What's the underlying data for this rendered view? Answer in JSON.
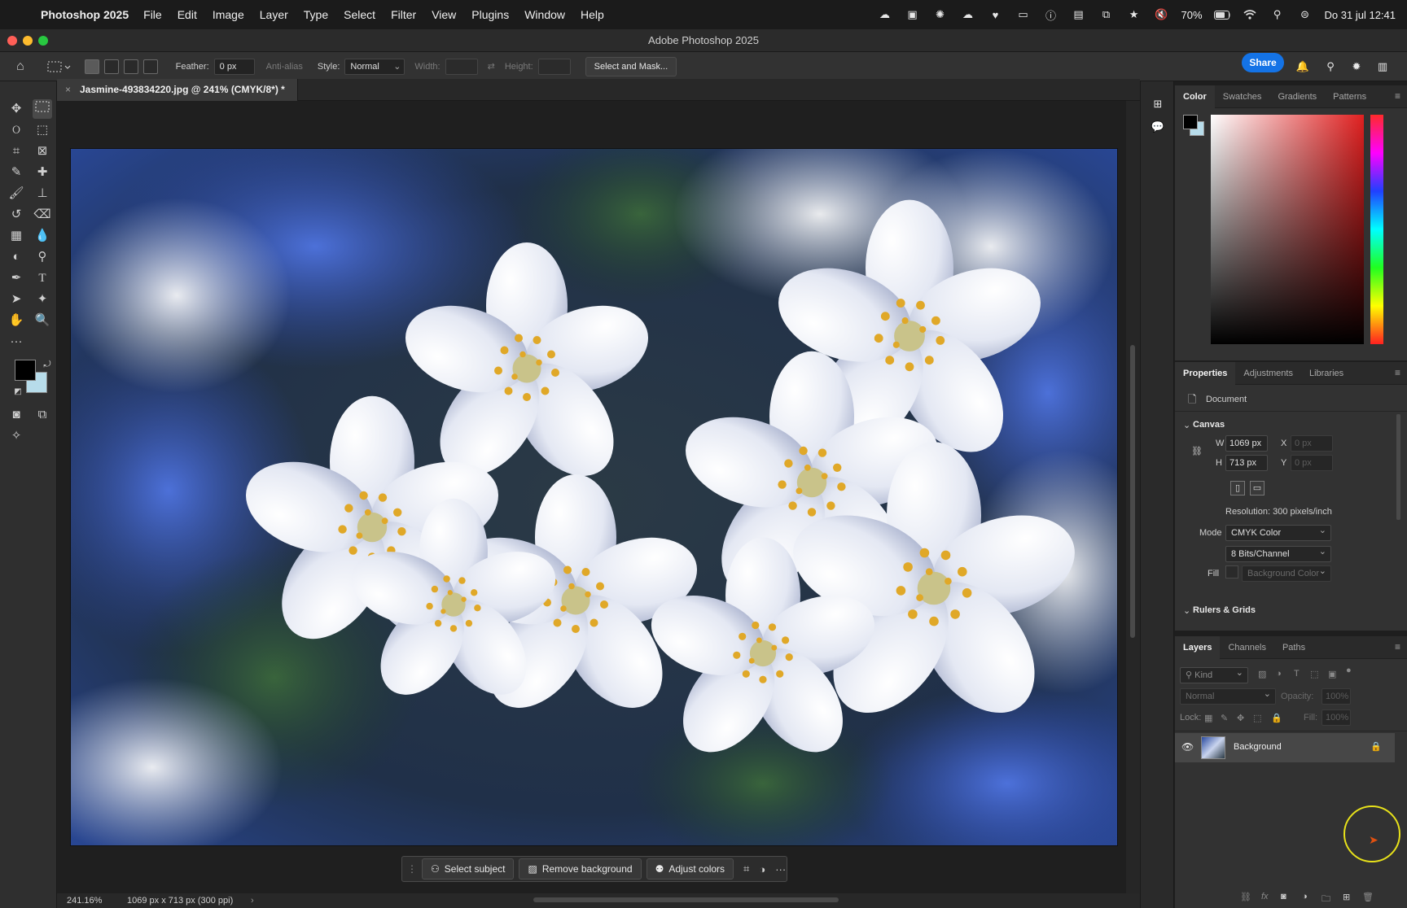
{
  "menubar": {
    "app_name": "Photoshop 2025",
    "menus": [
      "File",
      "Edit",
      "Image",
      "Layer",
      "Type",
      "Select",
      "Filter",
      "View",
      "Plugins",
      "Window",
      "Help"
    ],
    "battery": "70%",
    "datetime": "Do 31 jul  12:41"
  },
  "window": {
    "title": "Adobe Photoshop 2025"
  },
  "options_bar": {
    "feather_label": "Feather:",
    "feather_value": "0 px",
    "anti_alias": "Anti-alias",
    "style_label": "Style:",
    "style_value": "Normal",
    "width_label": "Width:",
    "height_label": "Height:",
    "select_mask": "Select and Mask...",
    "share": "Share"
  },
  "document": {
    "tab_title": "Jasmine-493834220.jpg @ 241% (CMYK/8*) *",
    "zoom": "241.16%",
    "info": "1069 px x 713 px (300 ppi)"
  },
  "context_bar": {
    "select_subject": "Select subject",
    "remove_background": "Remove background",
    "adjust_colors": "Adjust colors"
  },
  "color_panel": {
    "tabs": [
      "Color",
      "Swatches",
      "Gradients",
      "Patterns"
    ],
    "foreground": "#000000",
    "background": "#b7dcea",
    "hue": "#e02020"
  },
  "properties_panel": {
    "tabs": [
      "Properties",
      "Adjustments",
      "Libraries"
    ],
    "doc_label": "Document",
    "canvas_section": "Canvas",
    "w_label": "W",
    "w_value": "1069 px",
    "h_label": "H",
    "h_value": "713 px",
    "x_label": "X",
    "y_label": "Y",
    "xy_placeholder": "0 px",
    "resolution": "Resolution: 300 pixels/inch",
    "mode_label": "Mode",
    "mode_value": "CMYK Color",
    "bits_value": "8 Bits/Channel",
    "fill_label": "Fill",
    "fill_value": "Background Color",
    "rulers_section": "Rulers & Grids"
  },
  "layers_panel": {
    "tabs": [
      "Layers",
      "Channels",
      "Paths"
    ],
    "kind": "Kind",
    "blend_mode": "Normal",
    "opacity_label": "Opacity:",
    "opacity_value": "100%",
    "lock_label": "Lock:",
    "fill_label": "Fill:",
    "fill_value": "100%",
    "layers": [
      {
        "name": "Background",
        "visible": true,
        "locked": true
      }
    ]
  }
}
